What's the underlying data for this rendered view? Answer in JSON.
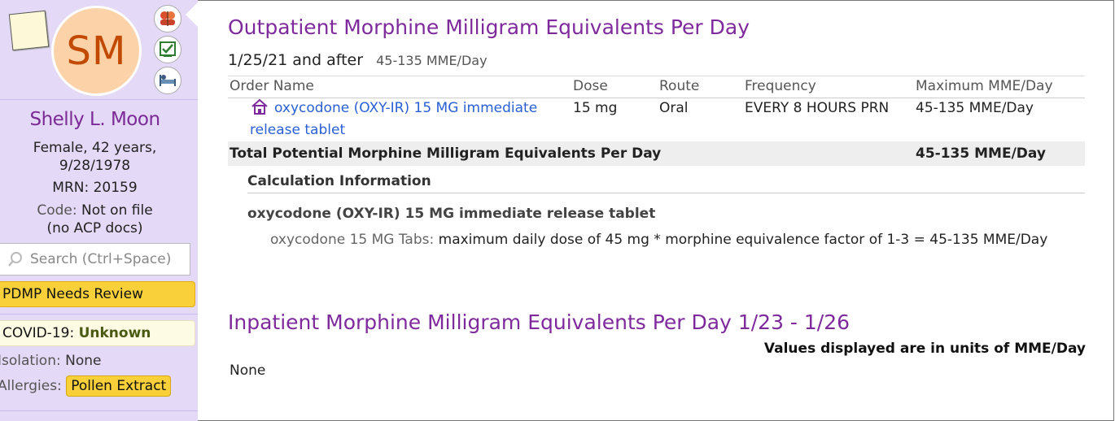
{
  "patient": {
    "initials": "SM",
    "name": "Shelly L. Moon",
    "demographics": "Female, 42 years,",
    "dob": "9/28/1978",
    "mrn": "MRN: 20159",
    "code_label": "Code:",
    "code_value": "Not on file",
    "acp": "(no ACP docs)"
  },
  "sidebar": {
    "search_placeholder": "Search (Ctrl+Space)",
    "pdmp_badge": "PDMP Needs Review",
    "covid_label": "COVID-19:",
    "covid_value": "Unknown",
    "isolation_label": "Isolation:",
    "isolation_value": "None",
    "allergies_label": "Allergies:",
    "allergies_value": "Pollen Extract",
    "icons": [
      "care-team-icon",
      "checklist-icon",
      "bed-icon"
    ]
  },
  "outpatient": {
    "title": "Outpatient Morphine Milligram Equivalents Per Day",
    "date_label": "1/25/21 and after",
    "date_range": "45-135 MME/Day",
    "columns": [
      "Order Name",
      "Dose",
      "Route",
      "Frequency",
      "Maximum MME/Day"
    ],
    "orders": [
      {
        "name_line1": "oxycodone (OXY-IR) 15 MG immediate",
        "name_line2": "release tablet",
        "dose": "15 mg",
        "route": "Oral",
        "frequency": "EVERY 8 HOURS PRN",
        "max_mme": "45-135 MME/Day"
      }
    ],
    "total_label": "Total Potential Morphine Milligram Equivalents Per Day",
    "total_value": "45-135 MME/Day",
    "calc_heading": "Calculation Information",
    "calc_drug": "oxycodone (OXY-IR) 15 MG immediate release tablet",
    "calc_prefix": "oxycodone 15 MG Tabs:",
    "calc_text": " maximum daily dose of 45 mg * morphine equivalence factor of 1-3 = 45-135 MME/Day"
  },
  "inpatient": {
    "title": "Inpatient Morphine Milligram Equivalents Per Day 1/23 - 1/26",
    "units_note": "Values displayed are in units of MME/Day",
    "value": "None"
  },
  "colors": {
    "sidebar_bg": "#e4d9f6",
    "heading_purple": "#7e2a9c",
    "badge_yellow": "#f9cf3a",
    "link_blue": "#2a5fd4"
  }
}
